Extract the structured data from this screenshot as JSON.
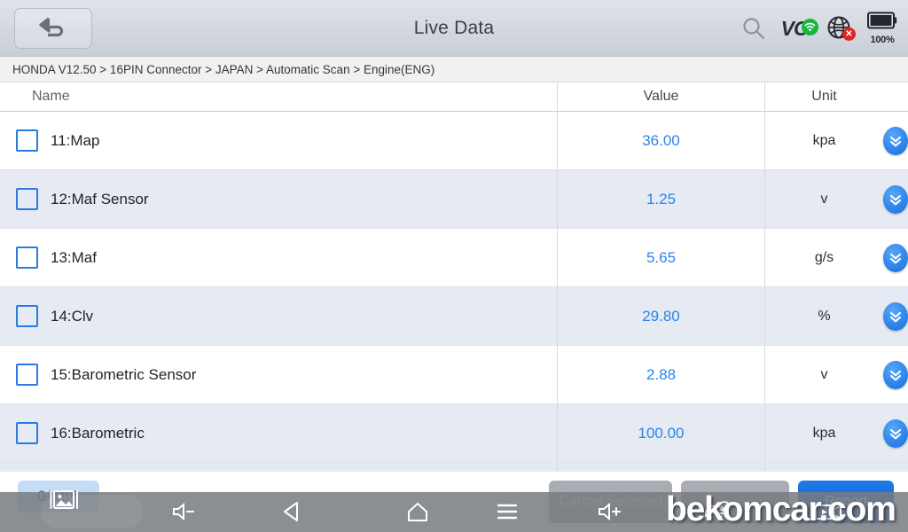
{
  "header": {
    "title": "Live Data",
    "back_icon": "back-arrow-icon",
    "search_icon": "search-icon",
    "vci_label": "VCI",
    "vci_status_icon": "wifi-icon",
    "network_icon": "globe-icon",
    "network_status_icon": "error-x-icon",
    "battery_icon": "battery-icon",
    "battery_level": "100%"
  },
  "breadcrumb": {
    "text": "HONDA V12.50 > 16PIN Connector  > JAPAN  > Automatic Scan  > Engine(ENG)"
  },
  "table": {
    "columns": [
      "Name",
      "Value",
      "Unit"
    ],
    "rows": [
      {
        "name": "11:Map",
        "value": "36.00",
        "unit": "kpa",
        "checked": false
      },
      {
        "name": "12:Maf Sensor",
        "value": "1.25",
        "unit": "v",
        "checked": false
      },
      {
        "name": "13:Maf",
        "value": "5.65",
        "unit": "g/s",
        "checked": false
      },
      {
        "name": "14:Clv",
        "value": "29.80",
        "unit": "%",
        "checked": false
      },
      {
        "name": "15:Barometric Sensor",
        "value": "2.88",
        "unit": "v",
        "checked": false
      },
      {
        "name": "16:Barometric",
        "value": "100.00",
        "unit": "kpa",
        "checked": false
      }
    ],
    "expand_icon": "chevron-double-down-icon"
  },
  "bottom": {
    "selection_count": "0/186",
    "screenshot_icon": "image-capture-icon",
    "cancel_label": "Cancel Selected",
    "middle_label": "",
    "report_label": "Report"
  },
  "navbar": {
    "volume_down_icon": "volume-down-icon",
    "back_icon": "triangle-back-icon",
    "home_icon": "home-icon",
    "menu_icon": "hamburger-menu-icon",
    "volume_up_icon": "volume-up-icon",
    "car_icon": "car-icon",
    "video_icon": "video-icon"
  },
  "watermark": {
    "text": "bekomcar.com"
  },
  "colors": {
    "accent_blue": "#2b84f0",
    "header_gray": "#d3d8e0",
    "row_even": "#e6eaf2",
    "button_blue": "#1f79e8",
    "status_green": "#16b83c",
    "status_red": "#e02424"
  }
}
